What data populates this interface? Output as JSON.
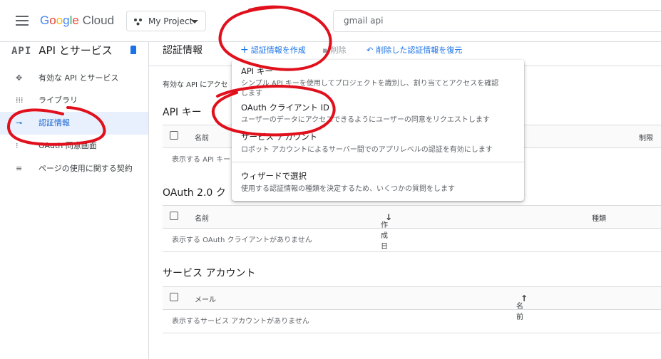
{
  "header": {
    "logo": {
      "g": "G",
      "o1": "o",
      "o2": "o",
      "g2": "g",
      "l": "l",
      "e": "e",
      "cloud": " Cloud"
    },
    "project": "My Project",
    "search_value": "gmail api"
  },
  "sidebar": {
    "title_icon": "API",
    "title": "API とサービス",
    "items": [
      {
        "label": "有効な API とサービス",
        "icon": "hub-icon"
      },
      {
        "label": "ライブラリ",
        "icon": "library-icon"
      },
      {
        "label": "認証情報",
        "icon": "key-icon"
      },
      {
        "label": "OAuth 同意画面",
        "icon": "consent-icon"
      },
      {
        "label": "ページの使用に関する契約",
        "icon": "settings-list-icon"
      }
    ]
  },
  "toolbar": {
    "title": "認証情報",
    "create": "認証情報を作成",
    "delete": "削除",
    "restore": "削除した認証情報を復元"
  },
  "main": {
    "intro": "有効な API にアクセ",
    "api_keys": {
      "title": "API キー",
      "col_name": "名前",
      "col_limit": "制限",
      "empty": "表示する API キー"
    },
    "oauth": {
      "title": "OAuth 2.0 ク",
      "col_name": "名前",
      "col_created": "作成日",
      "col_type": "種類",
      "empty": "表示する OAuth クライアントがありません"
    },
    "service": {
      "title": "サービス アカウント",
      "col_mail": "メール",
      "col_name": "名前",
      "empty": "表示するサービス アカウントがありません"
    }
  },
  "menu": {
    "items": [
      {
        "title": "API キー",
        "sub": "シンプル API キーを使用してプロジェクトを識別し、割り当てとアクセスを確認",
        "sub2": "します"
      },
      {
        "title": "OAuth クライアント ID",
        "sub": "ユーザーのデータにアクセスできるようにユーザーの同意をリクエストします"
      },
      {
        "title": "サービス アカウント",
        "sub": "ロボット アカウントによるサーバー間でのアプリレベルの認証を有効にします"
      },
      {
        "title": "ウィザードで選択",
        "sub": "使用する認証情報の種類を決定するため、いくつかの質問をします"
      }
    ]
  },
  "colors": {
    "accent": "#1a73e8",
    "ink": "#e0101c"
  }
}
